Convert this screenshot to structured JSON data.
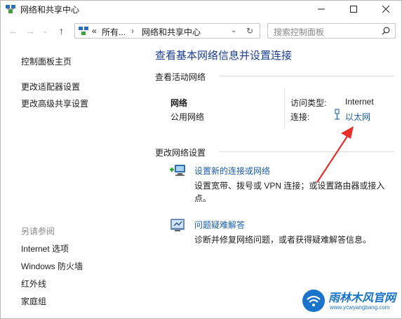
{
  "window": {
    "title": "网络和共享中心"
  },
  "address_bar": {
    "overflow": "«",
    "crumbs": [
      "所有...",
      "网络和共享中心"
    ],
    "search_placeholder": "搜索控制面板"
  },
  "sidebar": {
    "items": [
      "控制面板主页",
      "更改适配器设置",
      "更改高级共享设置"
    ],
    "see_also_header": "另请参阅",
    "see_also": [
      "Internet 选项",
      "Windows 防火墙",
      "红外线",
      "家庭组"
    ]
  },
  "main": {
    "heading": "查看基本网络信息并设置连接",
    "active_networks": {
      "title": "查看活动网络",
      "network_name": "网络",
      "network_type": "公用网络",
      "access_type_label": "访问类型:",
      "access_type_value": "Internet",
      "connections_label": "连接:",
      "connection_value": "以太网"
    },
    "change_settings": {
      "title": "更改网络设置",
      "items": [
        {
          "link": "设置新的连接或网络",
          "desc_line1": "设置宽带、拨号或 VPN 连接；或设置路由器或接入",
          "desc_line2": "点。",
          "icon": "network-setup-icon"
        },
        {
          "link": "问题疑难解答",
          "desc_line1": "诊断并修复网络问题，或者获得疑难解答信息。",
          "icon": "troubleshoot-icon"
        }
      ]
    }
  },
  "annotation": {
    "arrow_color": "#e8302a"
  },
  "watermark": {
    "text": "雨林木风官网",
    "url": "www.ycwyangbang.com"
  }
}
